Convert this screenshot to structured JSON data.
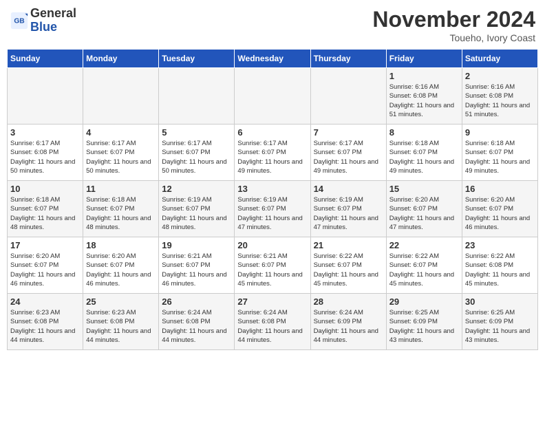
{
  "header": {
    "logo_line1": "General",
    "logo_line2": "Blue",
    "month_title": "November 2024",
    "location": "Toueho, Ivory Coast"
  },
  "days_of_week": [
    "Sunday",
    "Monday",
    "Tuesday",
    "Wednesday",
    "Thursday",
    "Friday",
    "Saturday"
  ],
  "weeks": [
    [
      {
        "day": "",
        "info": ""
      },
      {
        "day": "",
        "info": ""
      },
      {
        "day": "",
        "info": ""
      },
      {
        "day": "",
        "info": ""
      },
      {
        "day": "",
        "info": ""
      },
      {
        "day": "1",
        "info": "Sunrise: 6:16 AM\nSunset: 6:08 PM\nDaylight: 11 hours\nand 51 minutes."
      },
      {
        "day": "2",
        "info": "Sunrise: 6:16 AM\nSunset: 6:08 PM\nDaylight: 11 hours\nand 51 minutes."
      }
    ],
    [
      {
        "day": "3",
        "info": "Sunrise: 6:17 AM\nSunset: 6:08 PM\nDaylight: 11 hours\nand 50 minutes."
      },
      {
        "day": "4",
        "info": "Sunrise: 6:17 AM\nSunset: 6:07 PM\nDaylight: 11 hours\nand 50 minutes."
      },
      {
        "day": "5",
        "info": "Sunrise: 6:17 AM\nSunset: 6:07 PM\nDaylight: 11 hours\nand 50 minutes."
      },
      {
        "day": "6",
        "info": "Sunrise: 6:17 AM\nSunset: 6:07 PM\nDaylight: 11 hours\nand 49 minutes."
      },
      {
        "day": "7",
        "info": "Sunrise: 6:17 AM\nSunset: 6:07 PM\nDaylight: 11 hours\nand 49 minutes."
      },
      {
        "day": "8",
        "info": "Sunrise: 6:18 AM\nSunset: 6:07 PM\nDaylight: 11 hours\nand 49 minutes."
      },
      {
        "day": "9",
        "info": "Sunrise: 6:18 AM\nSunset: 6:07 PM\nDaylight: 11 hours\nand 49 minutes."
      }
    ],
    [
      {
        "day": "10",
        "info": "Sunrise: 6:18 AM\nSunset: 6:07 PM\nDaylight: 11 hours\nand 48 minutes."
      },
      {
        "day": "11",
        "info": "Sunrise: 6:18 AM\nSunset: 6:07 PM\nDaylight: 11 hours\nand 48 minutes."
      },
      {
        "day": "12",
        "info": "Sunrise: 6:19 AM\nSunset: 6:07 PM\nDaylight: 11 hours\nand 48 minutes."
      },
      {
        "day": "13",
        "info": "Sunrise: 6:19 AM\nSunset: 6:07 PM\nDaylight: 11 hours\nand 47 minutes."
      },
      {
        "day": "14",
        "info": "Sunrise: 6:19 AM\nSunset: 6:07 PM\nDaylight: 11 hours\nand 47 minutes."
      },
      {
        "day": "15",
        "info": "Sunrise: 6:20 AM\nSunset: 6:07 PM\nDaylight: 11 hours\nand 47 minutes."
      },
      {
        "day": "16",
        "info": "Sunrise: 6:20 AM\nSunset: 6:07 PM\nDaylight: 11 hours\nand 46 minutes."
      }
    ],
    [
      {
        "day": "17",
        "info": "Sunrise: 6:20 AM\nSunset: 6:07 PM\nDaylight: 11 hours\nand 46 minutes."
      },
      {
        "day": "18",
        "info": "Sunrise: 6:20 AM\nSunset: 6:07 PM\nDaylight: 11 hours\nand 46 minutes."
      },
      {
        "day": "19",
        "info": "Sunrise: 6:21 AM\nSunset: 6:07 PM\nDaylight: 11 hours\nand 46 minutes."
      },
      {
        "day": "20",
        "info": "Sunrise: 6:21 AM\nSunset: 6:07 PM\nDaylight: 11 hours\nand 45 minutes."
      },
      {
        "day": "21",
        "info": "Sunrise: 6:22 AM\nSunset: 6:07 PM\nDaylight: 11 hours\nand 45 minutes."
      },
      {
        "day": "22",
        "info": "Sunrise: 6:22 AM\nSunset: 6:07 PM\nDaylight: 11 hours\nand 45 minutes."
      },
      {
        "day": "23",
        "info": "Sunrise: 6:22 AM\nSunset: 6:08 PM\nDaylight: 11 hours\nand 45 minutes."
      }
    ],
    [
      {
        "day": "24",
        "info": "Sunrise: 6:23 AM\nSunset: 6:08 PM\nDaylight: 11 hours\nand 44 minutes."
      },
      {
        "day": "25",
        "info": "Sunrise: 6:23 AM\nSunset: 6:08 PM\nDaylight: 11 hours\nand 44 minutes."
      },
      {
        "day": "26",
        "info": "Sunrise: 6:24 AM\nSunset: 6:08 PM\nDaylight: 11 hours\nand 44 minutes."
      },
      {
        "day": "27",
        "info": "Sunrise: 6:24 AM\nSunset: 6:08 PM\nDaylight: 11 hours\nand 44 minutes."
      },
      {
        "day": "28",
        "info": "Sunrise: 6:24 AM\nSunset: 6:09 PM\nDaylight: 11 hours\nand 44 minutes."
      },
      {
        "day": "29",
        "info": "Sunrise: 6:25 AM\nSunset: 6:09 PM\nDaylight: 11 hours\nand 43 minutes."
      },
      {
        "day": "30",
        "info": "Sunrise: 6:25 AM\nSunset: 6:09 PM\nDaylight: 11 hours\nand 43 minutes."
      }
    ]
  ]
}
